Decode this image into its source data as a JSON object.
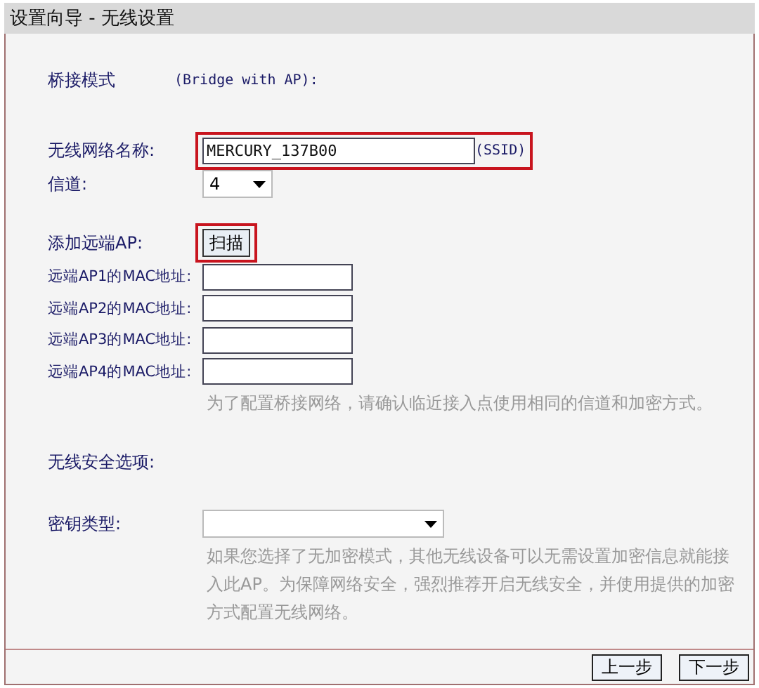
{
  "window": {
    "title": "设置向导 - 无线设置"
  },
  "mode": {
    "label": "桥接模式",
    "value": "(Bridge with AP):"
  },
  "ssid": {
    "label": "无线网络名称:",
    "value": "MERCURY_137B00",
    "suffix": "(SSID)",
    "highlighted": true
  },
  "channel": {
    "label": "信道:",
    "value": "4"
  },
  "add_ap": {
    "label": "添加远端AP:",
    "button": "扫描",
    "highlighted": true
  },
  "mac_fields": [
    {
      "label": "远端AP1的MAC地址:"
    },
    {
      "label": "远端AP2的MAC地址:"
    },
    {
      "label": "远端AP3的MAC地址:"
    },
    {
      "label": "远端AP4的MAC地址:"
    }
  ],
  "bridge_hint": "为了配置桥接网络，请确认临近接入点使用相同的信道和加密方式。",
  "security": {
    "label": "无线安全选项:"
  },
  "key_type": {
    "label": "密钥类型:",
    "hint": "如果您选择了无加密模式，其他无线设备可以无需设置加密信息就能接入此AP。为保障网络安全，强烈推荐开启无线安全，并使用提供的加密方式配置无线网络。"
  },
  "buttons": [
    "上一步",
    "下一步"
  ]
}
